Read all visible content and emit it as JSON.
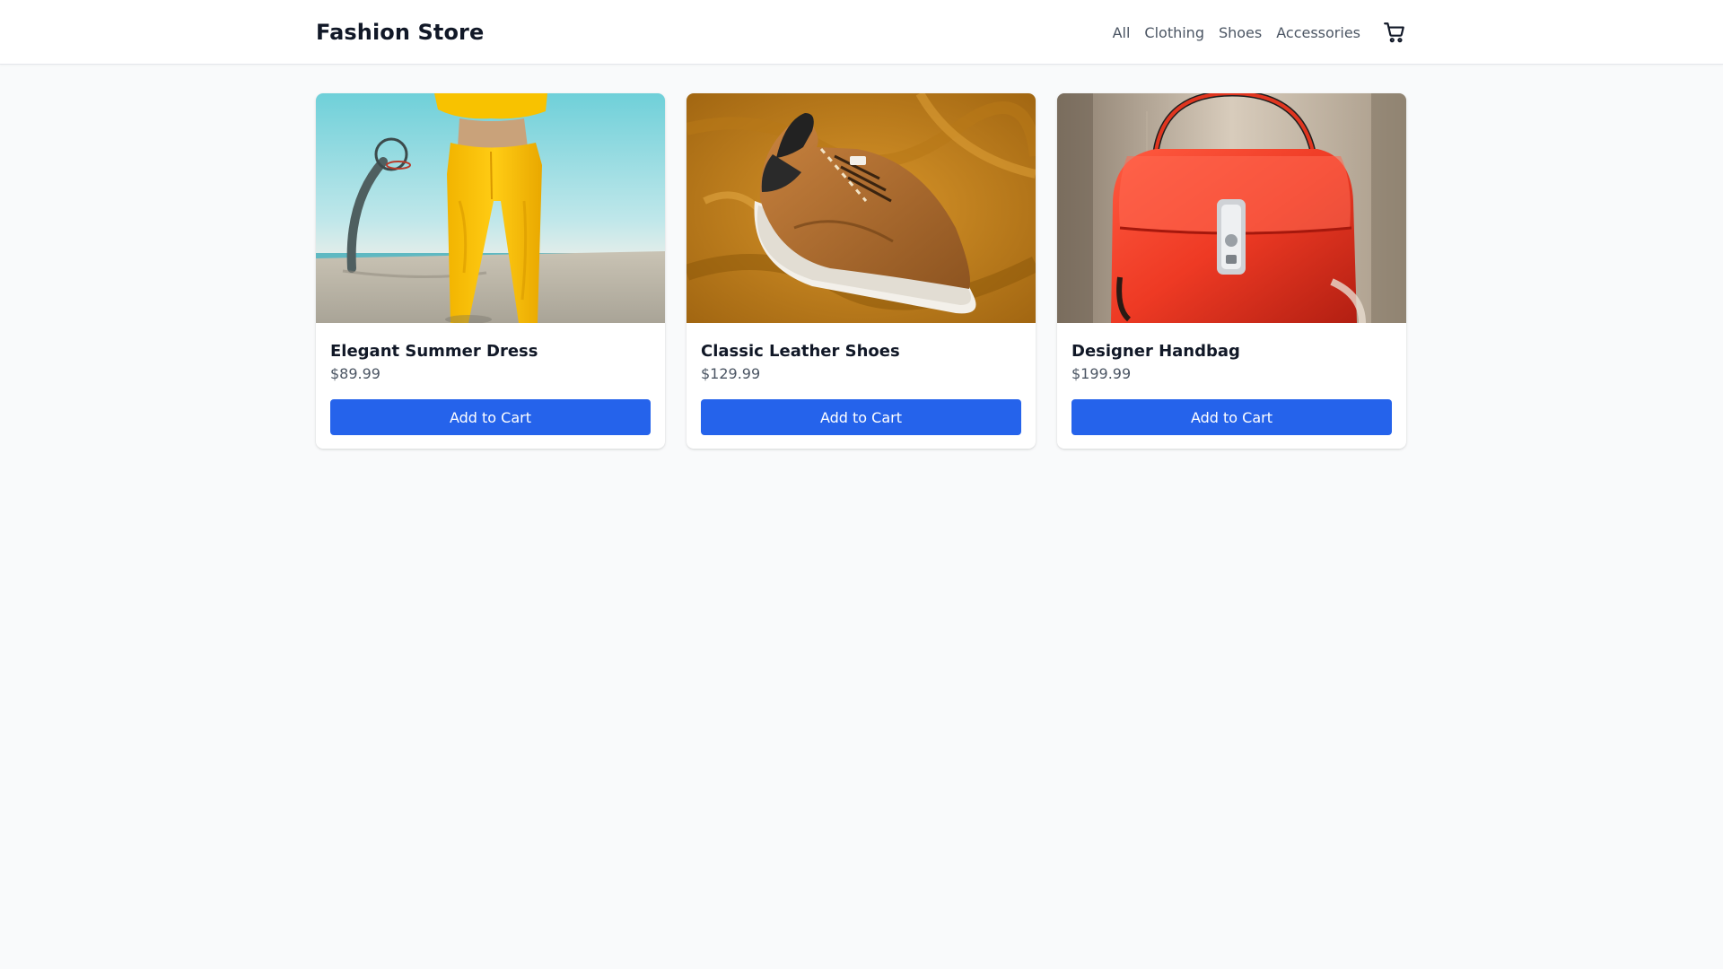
{
  "header": {
    "brand": "Fashion Store",
    "nav": [
      "All",
      "Clothing",
      "Shoes",
      "Accessories"
    ],
    "cart_icon": "shopping-cart-icon"
  },
  "products": [
    {
      "name": "Elegant Summer Dress",
      "price": "$89.99",
      "button": "Add to Cart",
      "image_icon": "yellow-sweatpants-photo"
    },
    {
      "name": "Classic Leather Shoes",
      "price": "$129.99",
      "button": "Add to Cart",
      "image_icon": "brown-sneaker-photo"
    },
    {
      "name": "Designer Handbag",
      "price": "$199.99",
      "button": "Add to Cart",
      "image_icon": "red-handbag-photo"
    }
  ],
  "colors": {
    "accent": "#2563eb",
    "background": "#f9fafb",
    "card": "#ffffff",
    "text_primary": "#111827",
    "text_secondary": "#4b5563"
  }
}
